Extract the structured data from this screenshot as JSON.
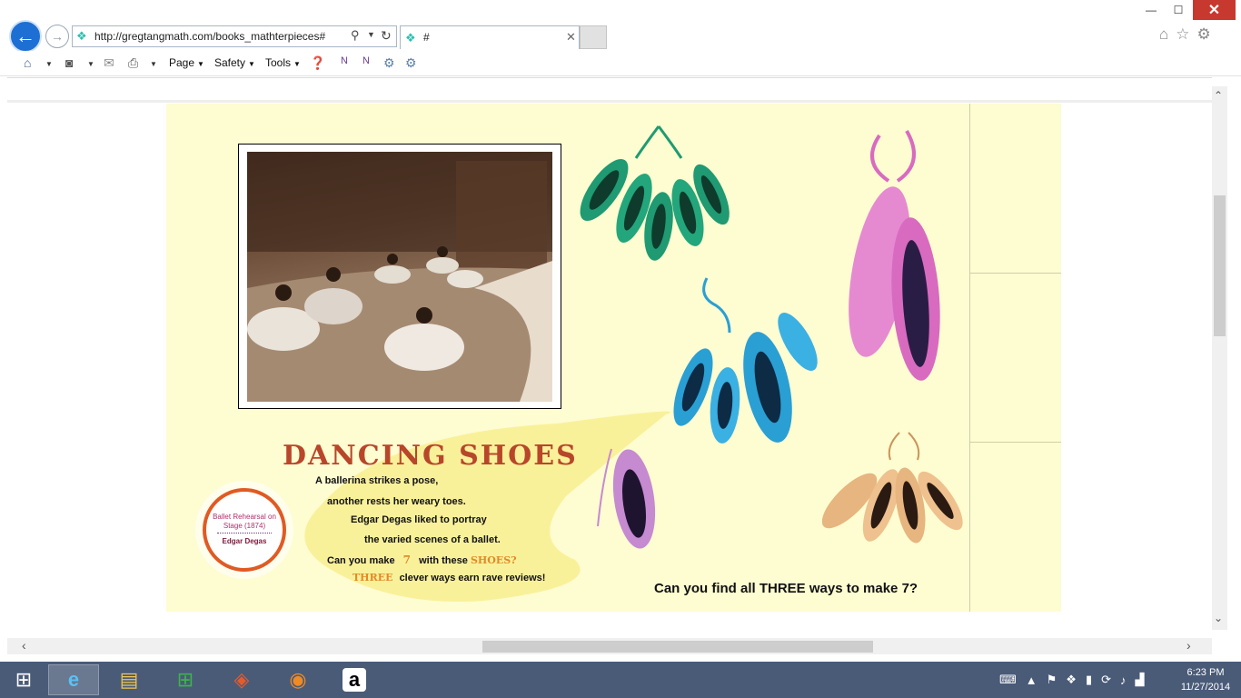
{
  "browser": {
    "url": "http://gregtangmath.com/books_mathterpieces#",
    "tab_title": "#",
    "window_buttons": {
      "minimize": "—",
      "maximize": "☐",
      "close": "✕"
    },
    "command_bar": {
      "page": "Page",
      "safety": "Safety",
      "tools": "Tools"
    }
  },
  "page": {
    "title": "DANCING SHOES",
    "poem": {
      "line1": "A ballerina strikes a pose,",
      "line2": "another rests her weary toes.",
      "line3": "Edgar Degas liked to portray",
      "line4": "the varied scenes of a ballet.",
      "line5_pre": "Can you make",
      "line5_num": "7",
      "line5_mid": "with these",
      "line5_word": "SHOES?",
      "line6_word": "THREE",
      "line6_post": "clever ways earn rave reviews!"
    },
    "badge": {
      "title": "Ballet Rehearsal on Stage (1874)",
      "artist": "Edgar Degas"
    },
    "question": "Can you find all THREE ways to make 7?",
    "shoe_colors": {
      "green": "#1f9a72",
      "blue": "#2a9fd4",
      "pink": "#d86bbf",
      "lilac": "#c58ad0",
      "peach": "#e7b57f"
    }
  },
  "taskbar": {
    "time": "6:23 PM",
    "date": "11/27/2014"
  }
}
